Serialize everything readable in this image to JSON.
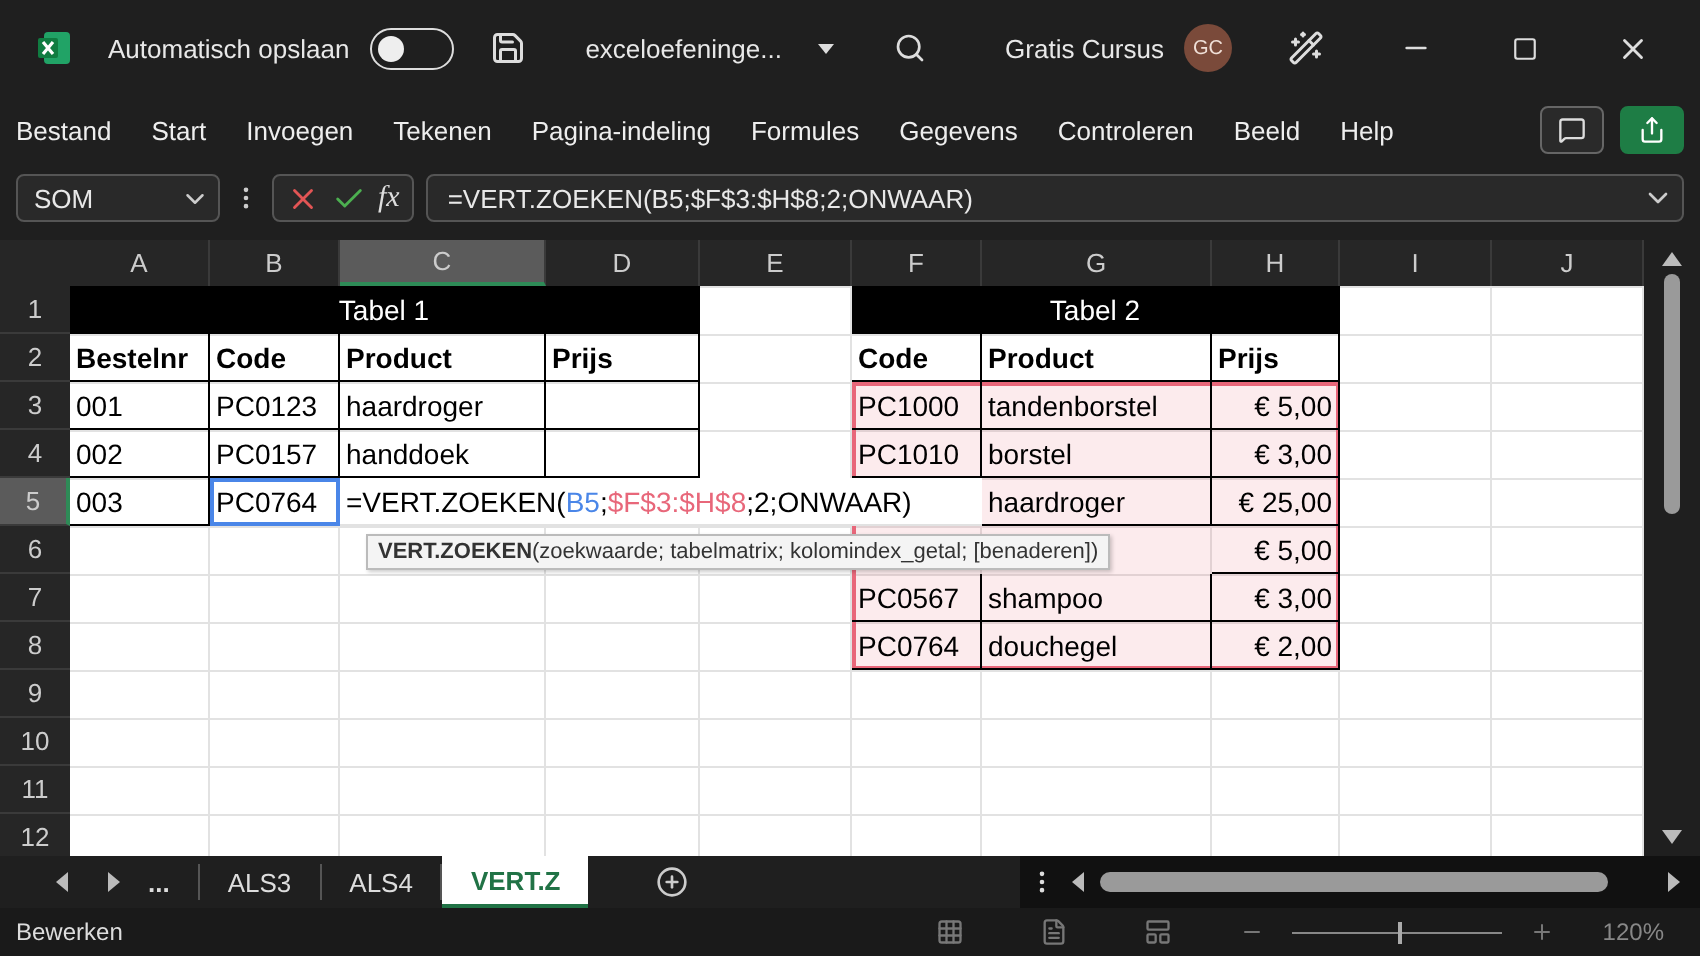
{
  "title_bar": {
    "autosave_label": "Automatisch opslaan",
    "autosave_on": false,
    "file_name": "exceloefeninge...",
    "account_name": "Gratis Cursus",
    "avatar_initials": "GC"
  },
  "menu": [
    "Bestand",
    "Start",
    "Invoegen",
    "Tekenen",
    "Pagina-indeling",
    "Formules",
    "Gegevens",
    "Controleren",
    "Beeld",
    "Help"
  ],
  "formula_bar": {
    "name_box": "SOM",
    "fx_label": "fx",
    "formula": "=VERT.ZOEKEN(B5;$F$3:$H$8;2;ONWAAR)"
  },
  "sheet": {
    "columns": [
      {
        "label": "A",
        "selected": false
      },
      {
        "label": "B",
        "selected": false
      },
      {
        "label": "C",
        "selected": true
      },
      {
        "label": "D",
        "selected": false
      },
      {
        "label": "E",
        "selected": false
      },
      {
        "label": "F",
        "selected": false
      },
      {
        "label": "G",
        "selected": false
      },
      {
        "label": "H",
        "selected": false
      },
      {
        "label": "I",
        "selected": false
      },
      {
        "label": "J",
        "selected": false
      }
    ],
    "rows": [
      {
        "label": "1",
        "selected": false
      },
      {
        "label": "2",
        "selected": false
      },
      {
        "label": "3",
        "selected": false
      },
      {
        "label": "4",
        "selected": false
      },
      {
        "label": "5",
        "selected": true
      },
      {
        "label": "6",
        "selected": false
      },
      {
        "label": "7",
        "selected": false
      },
      {
        "label": "8",
        "selected": false
      },
      {
        "label": "9",
        "selected": false
      },
      {
        "label": "10",
        "selected": false
      },
      {
        "label": "11",
        "selected": false
      },
      {
        "label": "12",
        "selected": false
      }
    ],
    "table_1": {
      "title": "Tabel 1",
      "headers": [
        "Bestelnr",
        "Code",
        "Product",
        "Prijs"
      ],
      "rows": [
        [
          "001",
          "PC0123",
          "haardroger"
        ],
        [
          "002",
          "PC0157",
          "handdoek"
        ],
        [
          "003",
          "PC0764"
        ]
      ]
    },
    "editing_cell": {
      "parts": [
        {
          "text": "=VERT.ZOEKEN(",
          "kind": "plain"
        },
        {
          "text": "B5",
          "kind": "ref",
          "color": "#4a86e8"
        },
        {
          "text": ";",
          "kind": "plain"
        },
        {
          "text": "$F$3:$H$8",
          "kind": "ref",
          "color": "#e8677a"
        },
        {
          "text": ";2;ONWAAR)",
          "kind": "plain"
        }
      ]
    },
    "table_2": {
      "title": "Tabel 2",
      "headers": [
        "Code",
        "Product",
        "Prijs"
      ],
      "rows": [
        {
          "code": "PC1000",
          "product": "tandenborstel",
          "price": "€ 5,00"
        },
        {
          "code": "PC1010",
          "product": "borstel",
          "price": "€ 3,00"
        },
        {
          "product": "haardroger",
          "price": "€ 25,00"
        },
        {
          "price": "€ 5,00"
        },
        {
          "code": "PC0567",
          "product": "shampoo",
          "price": "€ 3,00"
        },
        {
          "code": "PC0764",
          "product": "douchegel",
          "price": "€ 2,00"
        }
      ]
    },
    "tooltip": {
      "function_name": "VERT.ZOEKEN",
      "arguments": "(zoekwaarde; tabelmatrix; kolomindex_getal; [benaderen])"
    }
  },
  "sheet_tabs": [
    {
      "label": "ALS3",
      "selected": false
    },
    {
      "label": "ALS4",
      "selected": false
    },
    {
      "label": "VERT.Z",
      "selected": true
    }
  ],
  "more_tabs": "...",
  "status_bar": {
    "mode": "Bewerken",
    "zoom": "120%",
    "zoom_slider": {
      "level": 0.5
    }
  }
}
